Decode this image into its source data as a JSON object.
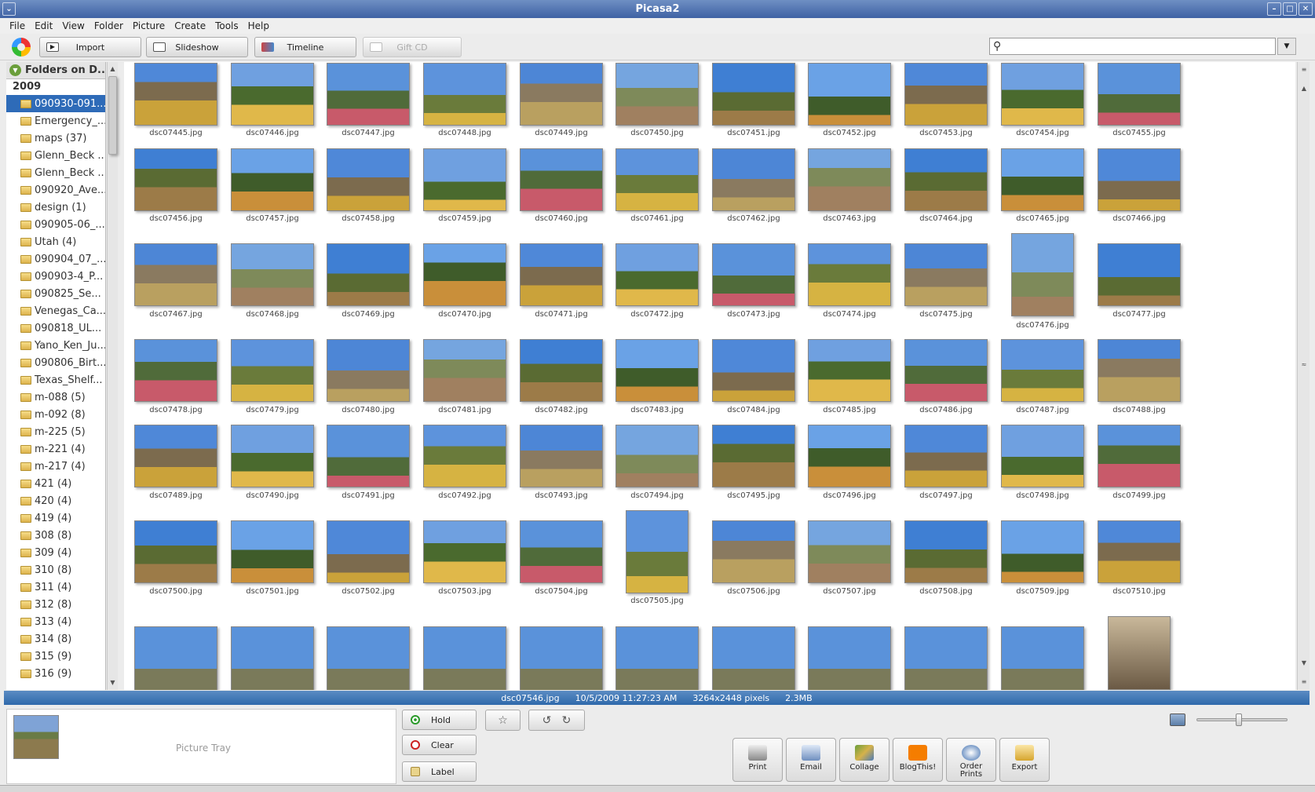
{
  "window": {
    "title": "Picasa2"
  },
  "menu": [
    "File",
    "Edit",
    "View",
    "Folder",
    "Picture",
    "Create",
    "Tools",
    "Help"
  ],
  "toolbar": {
    "import": "Import",
    "slideshow": "Slideshow",
    "timeline": "Timeline",
    "giftcd": "Gift CD"
  },
  "search": {
    "value": ""
  },
  "sidebar": {
    "header": "Folders on D...",
    "year": "2009",
    "folders": [
      "090930-091...",
      "Emergency_...",
      "maps (37)",
      "Glenn_Beck ...",
      "Glenn_Beck ...",
      "090920_Ave...",
      "design (1)",
      "090905-06_...",
      "Utah (4)",
      "090904_07_...",
      "090903-4_P...",
      "090825_Se...",
      "Venegas_Ca...",
      "090818_UL...",
      "Yano_Ken_Ju...",
      "090806_Birt...",
      "Texas_Shelf...",
      "m-088 (5)",
      "m-092 (8)",
      "m-225 (5)",
      "m-221 (4)",
      "m-217 (4)",
      "421 (4)",
      "420 (4)",
      "419 (4)",
      "308 (8)",
      "309 (4)",
      "310 (8)",
      "311 (4)",
      "312 (8)",
      "313 (4)",
      "314 (8)",
      "315 (9)",
      "316 (9)"
    ]
  },
  "photos": [
    "dsc07445.jpg",
    "dsc07446.jpg",
    "dsc07447.jpg",
    "dsc07448.jpg",
    "dsc07449.jpg",
    "dsc07450.jpg",
    "dsc07451.jpg",
    "dsc07452.jpg",
    "dsc07453.jpg",
    "dsc07454.jpg",
    "dsc07455.jpg",
    "dsc07456.jpg",
    "dsc07457.jpg",
    "dsc07458.jpg",
    "dsc07459.jpg",
    "dsc07460.jpg",
    "dsc07461.jpg",
    "dsc07462.jpg",
    "dsc07463.jpg",
    "dsc07464.jpg",
    "dsc07465.jpg",
    "dsc07466.jpg",
    "dsc07467.jpg",
    "dsc07468.jpg",
    "dsc07469.jpg",
    "dsc07470.jpg",
    "dsc07471.jpg",
    "dsc07472.jpg",
    "dsc07473.jpg",
    "dsc07474.jpg",
    "dsc07475.jpg",
    "dsc07476.jpg",
    "dsc07477.jpg",
    "dsc07478.jpg",
    "dsc07479.jpg",
    "dsc07480.jpg",
    "dsc07481.jpg",
    "dsc07482.jpg",
    "dsc07483.jpg",
    "dsc07484.jpg",
    "dsc07485.jpg",
    "dsc07486.jpg",
    "dsc07487.jpg",
    "dsc07488.jpg",
    "dsc07489.jpg",
    "dsc07490.jpg",
    "dsc07491.jpg",
    "dsc07492.jpg",
    "dsc07493.jpg",
    "dsc07494.jpg",
    "dsc07495.jpg",
    "dsc07496.jpg",
    "dsc07497.jpg",
    "dsc07498.jpg",
    "dsc07499.jpg",
    "dsc07500.jpg",
    "dsc07501.jpg",
    "dsc07502.jpg",
    "dsc07503.jpg",
    "dsc07504.jpg",
    "dsc07505.jpg",
    "dsc07506.jpg",
    "dsc07507.jpg",
    "dsc07508.jpg",
    "dsc07509.jpg",
    "dsc07510.jpg"
  ],
  "status": {
    "filename": "dsc07546.jpg",
    "datetime": "10/5/2009 11:27:23 AM",
    "dimensions": "3264x2448 pixels",
    "size": "2.3MB"
  },
  "tray": {
    "label": "Picture Tray",
    "hold": "Hold",
    "clear": "Clear",
    "labelbtn": "Label"
  },
  "actions": {
    "print": "Print",
    "email": "Email",
    "collage": "Collage",
    "blog": "BlogThis!",
    "order_line1": "Order",
    "order_line2": "Prints",
    "export": "Export"
  },
  "colors": {
    "selection": "#2e6bb8",
    "status_bar": "#3b74b3"
  }
}
